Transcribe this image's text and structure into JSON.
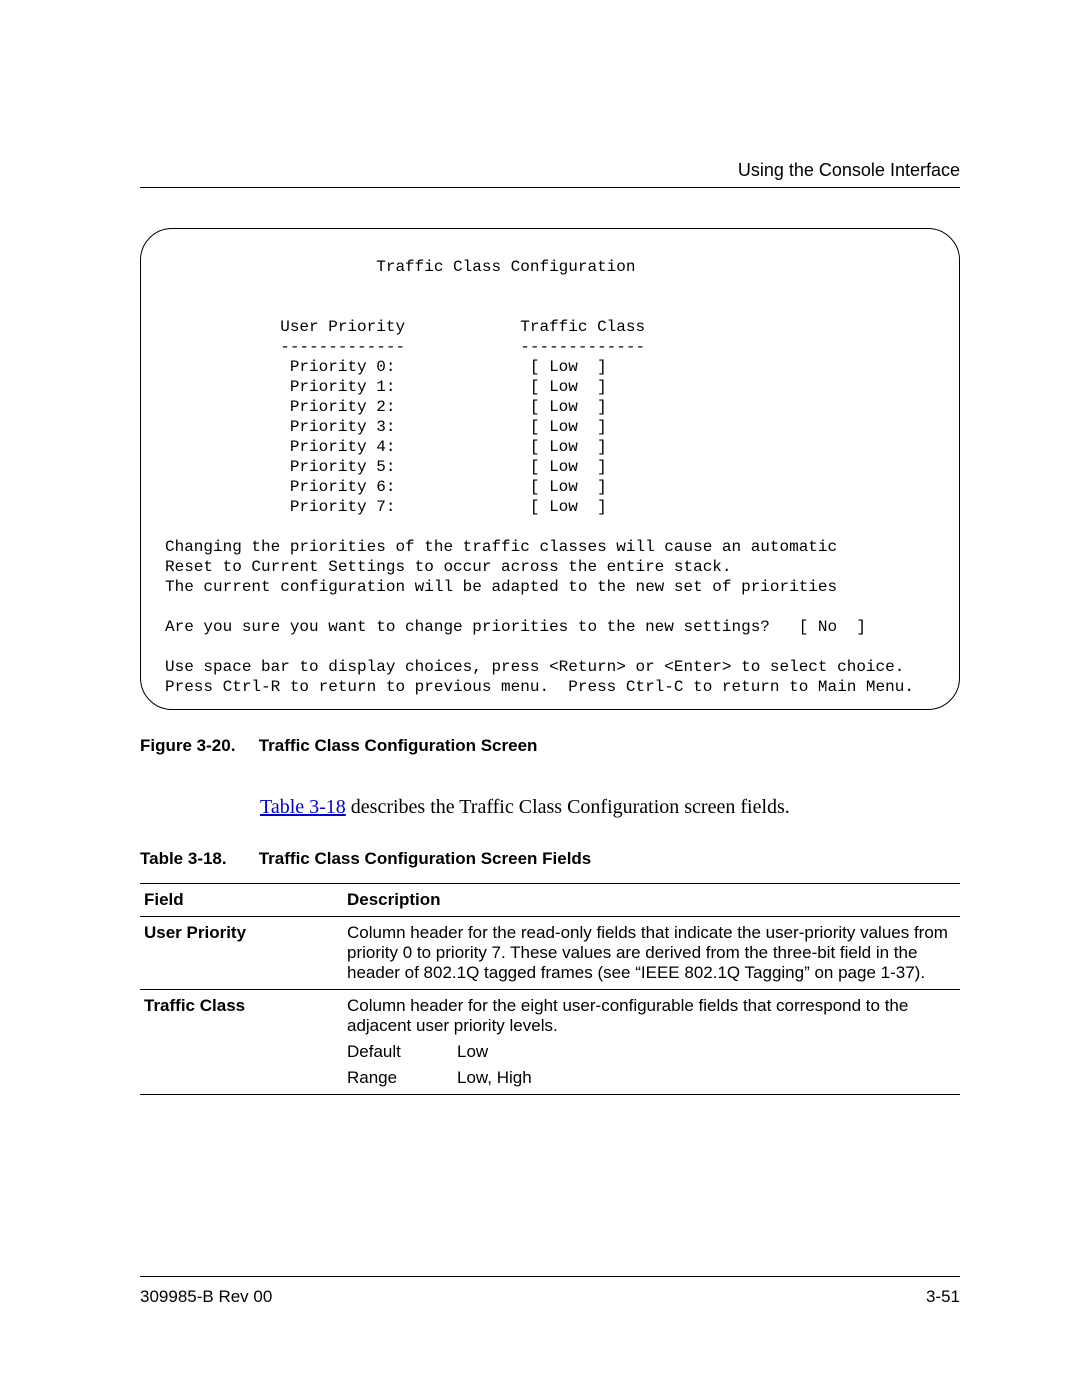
{
  "header": {
    "running_head": "Using the Console Interface"
  },
  "terminal": {
    "title": "Traffic Class Configuration",
    "col1_header": "User Priority",
    "col2_header": "Traffic Class",
    "rows": [
      {
        "label": "Priority 0:",
        "value": "[ Low  ]"
      },
      {
        "label": "Priority 1:",
        "value": "[ Low  ]"
      },
      {
        "label": "Priority 2:",
        "value": "[ Low  ]"
      },
      {
        "label": "Priority 3:",
        "value": "[ Low  ]"
      },
      {
        "label": "Priority 4:",
        "value": "[ Low  ]"
      },
      {
        "label": "Priority 5:",
        "value": "[ Low  ]"
      },
      {
        "label": "Priority 6:",
        "value": "[ Low  ]"
      },
      {
        "label": "Priority 7:",
        "value": "[ Low  ]"
      }
    ],
    "note1": "Changing the priorities of the traffic classes will cause an automatic",
    "note2": "Reset to Current Settings to occur across the entire stack.",
    "note3": "The current configuration will be adapted to the new set of priorities",
    "prompt_q": "Are you sure you want to change priorities to the new settings?",
    "prompt_val": "[ No  ]",
    "help1": "Use space bar to display choices, press <Return> or <Enter> to select choice.",
    "help2": "Press Ctrl-R to return to previous menu.  Press Ctrl-C to return to Main Menu."
  },
  "figure": {
    "label": "Figure 3-20.",
    "title": "Traffic Class Configuration Screen"
  },
  "intro": {
    "link_text": "Table 3-18",
    "rest": " describes the Traffic Class Configuration screen fields."
  },
  "table_caption": {
    "label": "Table 3-18.",
    "title": "Traffic Class Configuration Screen Fields"
  },
  "table_headers": {
    "field": "Field",
    "description": "Description"
  },
  "table_rows": [
    {
      "field": "User Priority",
      "description": "Column header for the read-only fields that indicate the user-priority values from priority 0 to priority 7. These values are derived from the three-bit field in the header of 802.1Q tagged frames (see “IEEE 802.1Q Tagging” on page 1-37).",
      "subrows": []
    },
    {
      "field": "Traffic Class",
      "description": "Column header for the eight user-configurable fields that correspond to the adjacent user priority levels.",
      "subrows": [
        {
          "label": "Default",
          "value": "Low"
        },
        {
          "label": "Range",
          "value": "Low, High"
        }
      ]
    }
  ],
  "footer": {
    "doc_id": "309985-B Rev 00",
    "page_num": "3-51"
  }
}
